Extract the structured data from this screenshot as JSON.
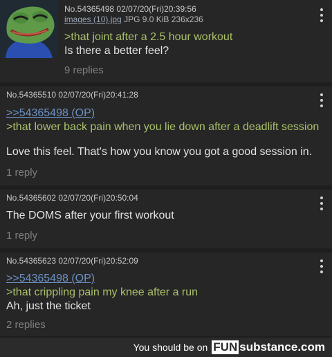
{
  "posts": [
    {
      "meta": "No.54365498 02/07/20(Fri)20:39:56",
      "file_name": "images (10).jpg",
      "file_info": "JPG 9.0 KiB 236x236",
      "lines": [
        ">that joint after a 2.5 hour workout",
        "Is there a better feel?"
      ],
      "replies": "9 replies"
    },
    {
      "meta": "No.54365510 02/07/20(Fri)20:41:28",
      "quote_link": ">>54365498 (OP)",
      "green": ">that lower back pain when you lie down after a deadlift session",
      "text": "Love this feel. That's how you know you got a good session in.",
      "replies": "1 reply"
    },
    {
      "meta": "No.54365602 02/07/20(Fri)20:50:04",
      "text": "The DOMS after your first workout",
      "replies": "1 reply"
    },
    {
      "meta": "No.54365623 02/07/20(Fri)20:52:09",
      "quote_link": ">>54365498 (OP)",
      "green": ">that crippling pain my knee after a run",
      "text": "Ah, just the ticket",
      "replies": "2 replies"
    }
  ],
  "footer": {
    "prefix": "You should be on",
    "brand_fun": "FUN",
    "brand_rest": "substance.com"
  },
  "colors": {
    "background": "#1e1e1e",
    "post_bg": "#262626",
    "greentext": "#a9c06a",
    "quote_link": "#6d92c6",
    "reply_count": "#7f7f7f"
  },
  "icons": [
    "frog-thumbnail",
    "more-vert-icon"
  ]
}
